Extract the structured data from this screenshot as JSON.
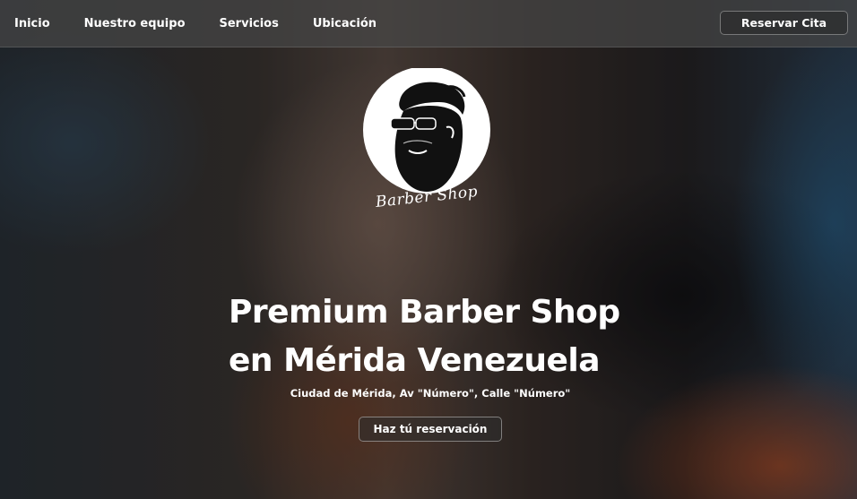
{
  "nav": {
    "links": [
      {
        "label": "Inicio"
      },
      {
        "label": "Nuestro equipo"
      },
      {
        "label": "Servicios"
      },
      {
        "label": "Ubicación"
      }
    ],
    "reserve_label": "Reservar Cita"
  },
  "logo": {
    "text": "Barber Shop",
    "icon": "bearded-man-sunglasses-icon"
  },
  "hero": {
    "title_line1": "Premium Barber Shop",
    "title_line2": "en Mérida Venezuela",
    "address": "Ciudad de Mérida, Av \"Número\", Calle \"Número\"",
    "cta_label": "Haz tú reservación"
  },
  "colors": {
    "text": "#ffffff",
    "navbar": "#464646",
    "logo_circle": "#ffffff",
    "logo_figure": "#111111"
  }
}
